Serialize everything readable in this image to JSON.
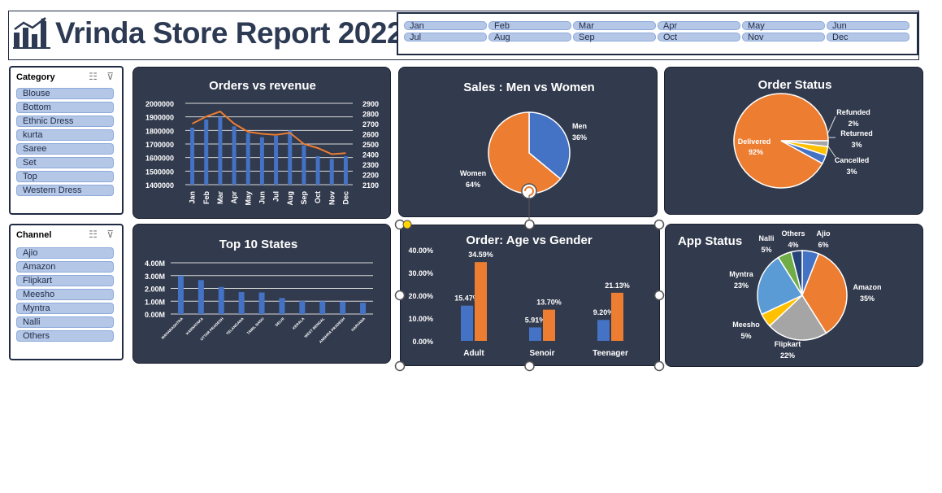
{
  "header": {
    "title": "Vrinda Store Report 2022",
    "months": [
      "Jan",
      "Feb",
      "Mar",
      "Apr",
      "May",
      "Jun",
      "Jul",
      "Aug",
      "Sep",
      "Oct",
      "Nov",
      "Dec"
    ]
  },
  "category_slicer": {
    "title": "Category",
    "items": [
      "Blouse",
      "Bottom",
      "Ethnic Dress",
      "kurta",
      "Saree",
      "Set",
      "Top",
      "Western Dress"
    ]
  },
  "channel_slicer": {
    "title": "Channel",
    "items": [
      "Ajio",
      "Amazon",
      "Flipkart",
      "Meesho",
      "Myntra",
      "Nalli",
      "Others"
    ]
  },
  "colors": {
    "card_bg": "#323a4d",
    "blue": "#4472c4",
    "orange": "#ed7d31",
    "gray": "#a5a5a5",
    "yellow": "#ffc000",
    "lightblue": "#5b9bd5",
    "green": "#70ad47",
    "darkblue": "#264478",
    "slicer_item": "#b4c7e7"
  },
  "chart_data": [
    {
      "type": "bar",
      "title": "Orders vs revenue",
      "categories": [
        "Jan",
        "Feb",
        "Mar",
        "Apr",
        "May",
        "Jun",
        "Jul",
        "Aug",
        "Sep",
        "Oct",
        "Nov",
        "Dec"
      ],
      "series": [
        {
          "values": [
            1820000,
            1880000,
            1900000,
            1830000,
            1780000,
            1750000,
            1760000,
            1800000,
            1690000,
            1610000,
            1590000,
            1610000
          ]
        },
        {
          "values": [
            2700,
            2770,
            2820,
            2700,
            2620,
            2600,
            2590,
            2610,
            2500,
            2460,
            2400,
            2410
          ]
        }
      ],
      "y_ticks": [
        "2000000",
        "1900000",
        "1800000",
        "1700000",
        "1600000",
        "1500000",
        "1400000"
      ],
      "y2_ticks": [
        "2900",
        "2800",
        "2700",
        "2600",
        "2500",
        "2400",
        "2300",
        "2200",
        "2100"
      ],
      "ylim": [
        1400000,
        2000000
      ],
      "y2lim": [
        2100,
        2900
      ]
    },
    {
      "type": "pie",
      "title": "Sales : Men vs Women",
      "labels": [
        "Men",
        "Women"
      ],
      "values": [
        36,
        64
      ],
      "value_labels": [
        "36%",
        "64%"
      ]
    },
    {
      "type": "pie",
      "title": "Order Status",
      "labels": [
        "Delivered",
        "Refunded",
        "Returned",
        "Cancelled"
      ],
      "values": [
        92,
        2,
        3,
        3
      ],
      "value_labels": [
        "92%",
        "2%",
        "3%",
        "3%"
      ]
    },
    {
      "type": "bar",
      "title": "Top 10 States",
      "categories": [
        "MAHARASHTRA",
        "KARNATAKA",
        "UTTAR PRADESH",
        "TELANGANA",
        "TAMIL NADU",
        "DELHI",
        "KERALA",
        "WEST BENGAL",
        "ANDHRA PRADESH",
        "HARYANA"
      ],
      "values": [
        2990000,
        2650000,
        2110000,
        1710000,
        1680000,
        1250000,
        1010000,
        1000000,
        980000,
        880000
      ],
      "y_ticks": [
        "4.00M",
        "3.00M",
        "2.00M",
        "1.00M",
        "0.00M"
      ],
      "ylim": [
        0,
        4000000
      ]
    },
    {
      "type": "bar",
      "title": "Order: Age vs Gender",
      "categories": [
        "Adult",
        "Senoir",
        "Teenager"
      ],
      "series": [
        {
          "values": [
            15.47,
            5.91,
            9.2
          ],
          "value_labels": [
            "15.47%",
            "5.91%",
            "9.20%"
          ]
        },
        {
          "values": [
            34.59,
            13.7,
            21.13
          ],
          "value_labels": [
            "34.59%",
            "13.70%",
            "21.13%"
          ]
        }
      ],
      "y_ticks": [
        "40.00%",
        "30.00%",
        "20.00%",
        "10.00%",
        "0.00%"
      ],
      "ylim": [
        0,
        40
      ]
    },
    {
      "type": "pie",
      "title": "App Status",
      "labels": [
        "Ajio",
        "Amazon",
        "Flipkart",
        "Meesho",
        "Myntra",
        "Nalli",
        "Others"
      ],
      "values": [
        6,
        35,
        22,
        5,
        23,
        5,
        4
      ],
      "value_labels": [
        "6%",
        "35%",
        "22%",
        "5%",
        "23%",
        "5%",
        "4%"
      ]
    }
  ]
}
